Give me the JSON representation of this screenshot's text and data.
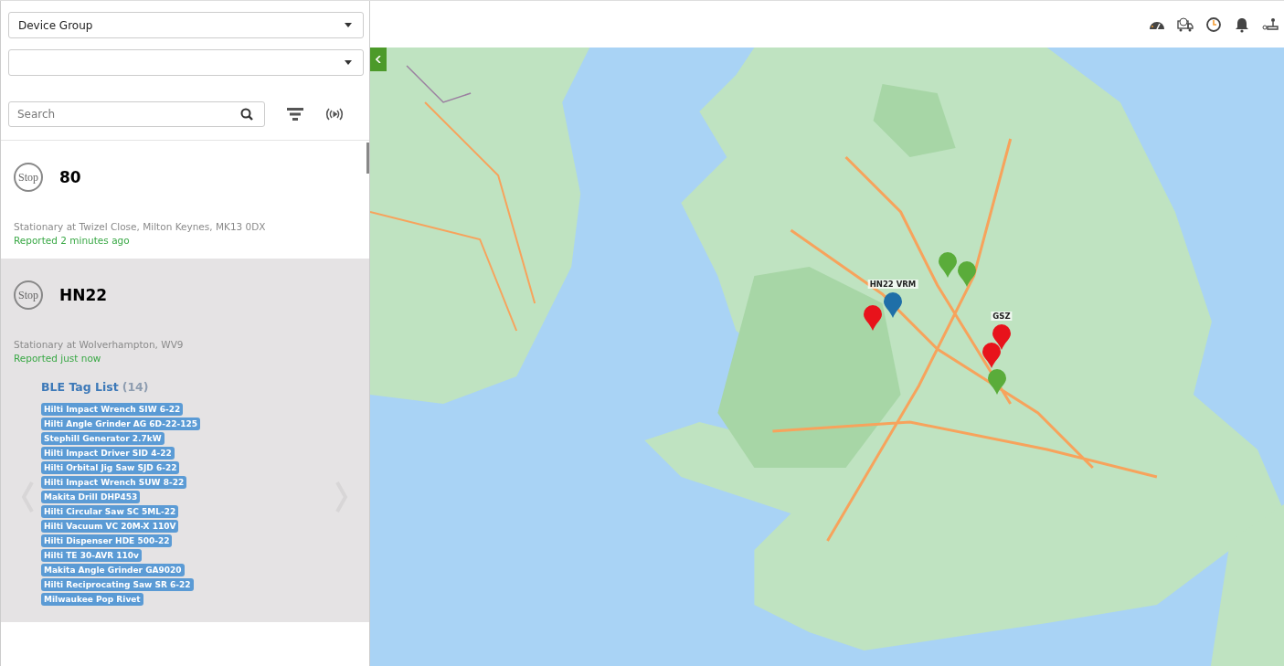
{
  "filters": {
    "device_group": {
      "value": "Device Group"
    },
    "search": {
      "placeholder": "Search"
    }
  },
  "devices": [
    {
      "status": "Stop",
      "name": "80",
      "location": "Stationary at Twizel Close, Milton Keynes, MK13 0DX",
      "reported": "Reported 2 minutes ago",
      "selected": false
    },
    {
      "status": "Stop",
      "name": "HN22",
      "location": "Stationary at Wolverhampton, WV9",
      "reported": "Reported just now",
      "selected": true,
      "ble": {
        "title": "BLE Tag List",
        "count": "(14)",
        "tags": [
          "Hilti Impact Wrench SIW 6-22",
          "Hilti Angle Grinder AG 6D-22-125",
          "Stephill Generator 2.7kW",
          "Hilti Impact Driver SID 4-22",
          "Hilti Orbital Jig Saw SJD 6-22",
          "Hilti Impact Wrench SUW 8-22",
          "Makita Drill DHP453",
          "Hilti Circular Saw SC 5ML-22",
          "Hilti Vacuum VC 20M-X 110V",
          "Hilti Dispenser HDE 500-22",
          "Hilti TE 30-AVR 110v",
          "Makita Angle Grinder GA9020",
          "Hilti Reciprocating Saw SR 6-22",
          "Milwaukee Pop Rivet"
        ]
      }
    }
  ],
  "map": {
    "kind": "picture",
    "markers": [
      {
        "color": "#e8131b"
      },
      {
        "color": "#1f6fa8",
        "label": "HN22 VRM"
      },
      {
        "color": "#5aac3a"
      },
      {
        "color": "#5aac3a"
      },
      {
        "color": "#e8131b",
        "label": "GSZ"
      },
      {
        "color": "#e8131b"
      },
      {
        "color": "#5aac3a"
      }
    ]
  }
}
